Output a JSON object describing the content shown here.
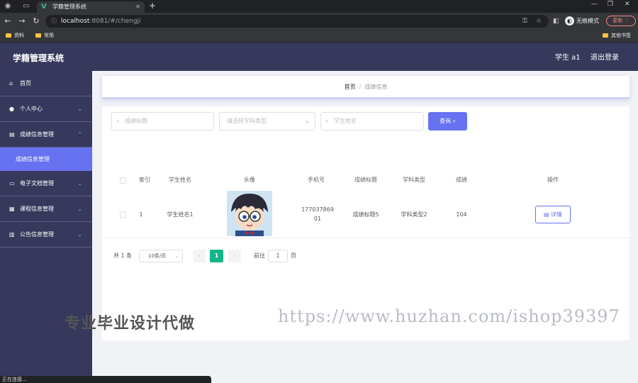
{
  "browser": {
    "tab_title": "学籍管理系统",
    "url_host": "localhost",
    "url_path": ":8081/#/chengji",
    "incognito_label": "无痕模式",
    "update_label": "更新",
    "bookmarks": [
      "资料",
      "常用"
    ],
    "other_bookmarks": "其他书签",
    "status_text": "正在连接..."
  },
  "header": {
    "title": "学籍管理系统",
    "user": "学生 a1",
    "logout": "退出登录"
  },
  "sidebar": {
    "items": [
      {
        "label": "首页",
        "icon": "home-icon"
      },
      {
        "label": "个人中心",
        "icon": "user-icon"
      },
      {
        "label": "成绩信息管理",
        "icon": "grade-icon"
      },
      {
        "label": "电子文档管理",
        "icon": "document-icon"
      },
      {
        "label": "课程信息管理",
        "icon": "course-icon"
      },
      {
        "label": "公告信息管理",
        "icon": "notice-icon"
      }
    ],
    "active_sub": "成绩信息管理"
  },
  "breadcrumb": {
    "home": "首页",
    "current": "成绩信息"
  },
  "filters": {
    "title_placeholder": "成绩标题",
    "subject_placeholder": "请选择学科类型",
    "name_placeholder": "学生姓名",
    "query_label": "查询"
  },
  "table": {
    "headers": [
      "索引",
      "学生姓名",
      "头像",
      "手机号",
      "成绩标题",
      "学科类型",
      "成绩",
      "操作"
    ],
    "rows": [
      {
        "index": "1",
        "name": "学生姓名1",
        "phone": "17703786901",
        "title": "成绩标题5",
        "subject": "学科类型2",
        "score": "104",
        "action": "详情"
      }
    ]
  },
  "pagination": {
    "total": "共 1 条",
    "page_size": "10条/页",
    "current_page": "1",
    "goto_label": "前往",
    "goto_value": "1",
    "page_label": "页"
  },
  "watermark": {
    "left": "专业毕业设计代做",
    "right": "https://www.huzhan.com/ishop39397"
  },
  "colors": {
    "sidebar_bg": "#36395c",
    "accent": "#6672f0",
    "page_active": "#13b589"
  }
}
